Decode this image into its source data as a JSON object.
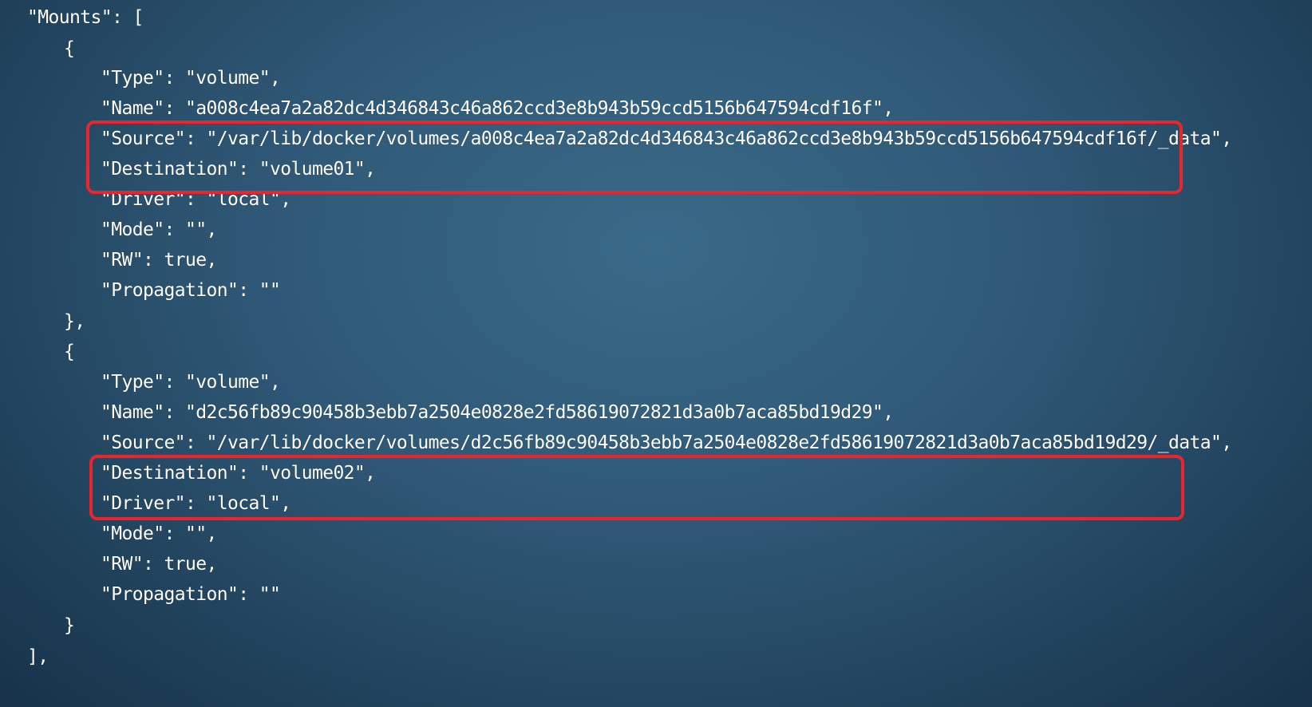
{
  "highlight_color": "#e8262c",
  "background_color": "#2e5775",
  "lines": [
    "\"Mounts\": [",
    "{",
    "\"Type\": \"volume\",",
    "\"Name\": \"a008c4ea7a2a82dc4d346843c46a862ccd3e8b943b59ccd5156b647594cdf16f\",",
    "\"Source\": \"/var/lib/docker/volumes/a008c4ea7a2a82dc4d346843c46a862ccd3e8b943b59ccd5156b647594cdf16f/_data\",",
    "\"Destination\": \"volume01\",",
    "\"Driver\": \"local\",",
    "\"Mode\": \"\",",
    "\"RW\": true,",
    "\"Propagation\": \"\"",
    "},",
    "{",
    "\"Type\": \"volume\",",
    "\"Name\": \"d2c56fb89c90458b3ebb7a2504e0828e2fd58619072821d3a0b7aca85bd19d29\",",
    "\"Source\": \"/var/lib/docker/volumes/d2c56fb89c90458b3ebb7a2504e0828e2fd58619072821d3a0b7aca85bd19d29/_data\",",
    "\"Destination\": \"volume02\",",
    "\"Driver\": \"local\",",
    "\"Mode\": \"\",",
    "\"RW\": true,",
    "\"Propagation\": \"\"",
    "}",
    "],"
  ]
}
